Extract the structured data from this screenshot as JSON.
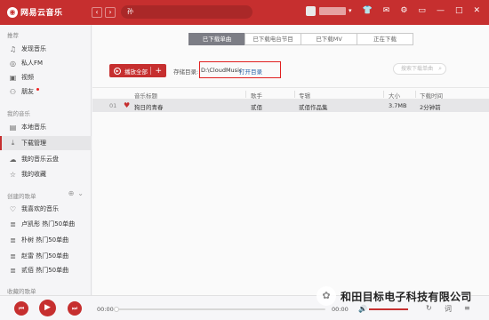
{
  "app": {
    "logo_text": "网易云音乐",
    "search_value": "孙",
    "brand_color": "#c62f2f"
  },
  "sidebar": {
    "recommend_title": "推荐",
    "recommend_items": [
      {
        "label": "发现音乐",
        "icon": "music-note-icon"
      },
      {
        "label": "私人FM",
        "icon": "radio-icon"
      },
      {
        "label": "视频",
        "icon": "video-icon"
      },
      {
        "label": "朋友",
        "icon": "friends-icon"
      }
    ],
    "my_music_title": "我的音乐",
    "my_music_items": [
      {
        "label": "本地音乐",
        "icon": "local-music-icon"
      },
      {
        "label": "下载管理",
        "icon": "download-icon",
        "active": true
      },
      {
        "label": "我的音乐云盘",
        "icon": "cloud-icon"
      },
      {
        "label": "我的收藏",
        "icon": "collection-icon"
      }
    ],
    "created_title": "创建的歌单",
    "playlists": [
      {
        "label": "我喜欢的音乐",
        "icon": "heart-outline-icon"
      },
      {
        "label": "卢凯彤 热门50单曲",
        "icon": "playlist-icon"
      },
      {
        "label": "朴树 热门50单曲",
        "icon": "playlist-icon"
      },
      {
        "label": "赵雷 热门50单曲",
        "icon": "playlist-icon"
      },
      {
        "label": "贰佰 热门50单曲",
        "icon": "playlist-icon"
      }
    ],
    "collected_title": "收藏的歌单"
  },
  "main": {
    "tabs": [
      "已下载单曲",
      "已下载电台节目",
      "已下载MV",
      "正在下载"
    ],
    "play_all_label": "播放全部",
    "storage_label": "存储目录:",
    "storage_path": "D:\\CloudMusic",
    "open_dir_label": "打开目录",
    "search_placeholder": "搜索下载单曲",
    "columns": [
      "音乐标题",
      "歌手",
      "专辑",
      "大小",
      "下载时间"
    ],
    "rows": [
      {
        "index": "01",
        "title": "狗日的青春",
        "artist": "贰佰",
        "album": "贰佰作品集",
        "size": "3.7MB",
        "time": "2分钟前"
      }
    ]
  },
  "player": {
    "current_time": "00:00",
    "total_time": "00:00",
    "progress": 0,
    "volume": 1
  },
  "watermark": {
    "text": "和田目标电子科技有限公司"
  }
}
